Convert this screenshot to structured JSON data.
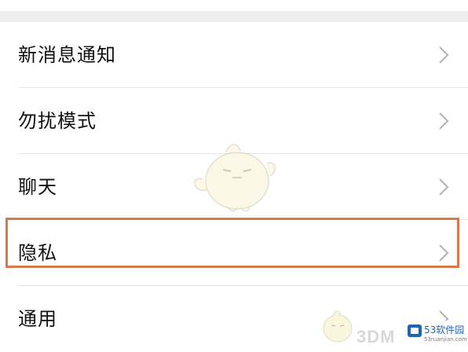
{
  "settings": {
    "items": [
      {
        "label": "新消息通知",
        "icon": "chevron-right"
      },
      {
        "label": "勿扰模式",
        "icon": "chevron-right"
      },
      {
        "label": "聊天",
        "icon": "chevron-right"
      },
      {
        "label": "隐私",
        "icon": "chevron-right",
        "highlighted": true
      },
      {
        "label": "通用",
        "icon": "chevron-right"
      }
    ]
  },
  "watermark": {
    "text": "3DM",
    "site_name": "53软件园",
    "site_url": "53ruanjian.com"
  },
  "colors": {
    "highlight_border": "#d9774f",
    "background": "#ededed",
    "row_background": "#ffffff",
    "text": "#111111",
    "chevron": "#b3b3b3",
    "site_blue": "#1b66b8"
  }
}
